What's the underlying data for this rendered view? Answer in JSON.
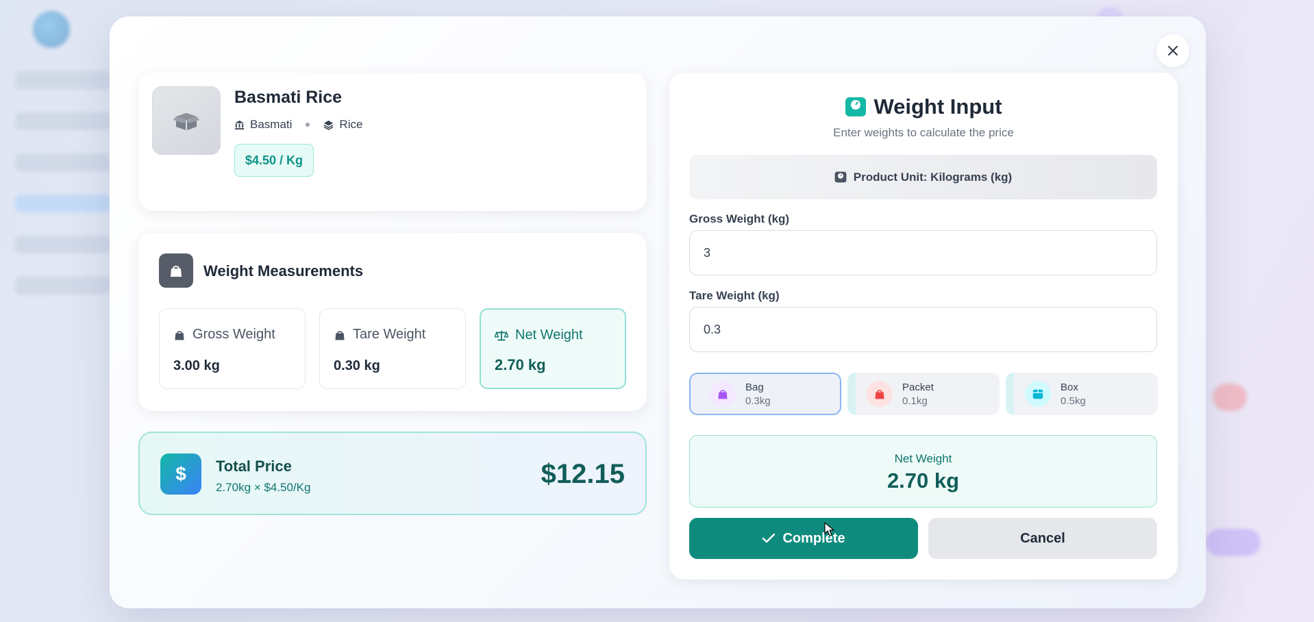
{
  "product": {
    "name": "Basmati Rice",
    "brand": "Basmati",
    "category": "Rice",
    "price_badge": "$4.50 / Kg",
    "icons": {
      "image": "box-open-icon",
      "brand": "landmark-icon",
      "category": "layers-icon"
    }
  },
  "measurements": {
    "title": "Weight Measurements",
    "icon": "weight-bag-icon",
    "gross": {
      "label": "Gross Weight",
      "value": "3.00 kg"
    },
    "tare": {
      "label": "Tare Weight",
      "value": "0.30 kg"
    },
    "net": {
      "label": "Net Weight",
      "value": "2.70 kg",
      "icon": "scale-icon"
    }
  },
  "total": {
    "title": "Total Price",
    "formula": "2.70kg × $4.50/Kg",
    "amount": "$12.15",
    "icon": "dollar-icon"
  },
  "weight_input": {
    "title": "Weight Input",
    "subtitle": "Enter weights to calculate the price",
    "unit_label": "Product Unit: Kilograms (kg)",
    "gross_label": "Gross Weight (kg)",
    "gross_value": "3",
    "tare_label": "Tare Weight (kg)",
    "tare_value": "0.3",
    "tare_options": [
      {
        "name": "Bag",
        "weight": "0.3kg",
        "color": "#a855f7",
        "selected": true
      },
      {
        "name": "Packet",
        "weight": "0.1kg",
        "color": "#ef4444",
        "selected": false
      },
      {
        "name": "Box",
        "weight": "0.5kg",
        "color": "#06b6d4",
        "selected": false
      }
    ],
    "net_label": "Net Weight",
    "net_value": "2.70 kg",
    "complete_label": "Complete",
    "cancel_label": "Cancel"
  },
  "colors": {
    "accent": "#0f8b7d",
    "teal_light": "#eefaf7"
  }
}
